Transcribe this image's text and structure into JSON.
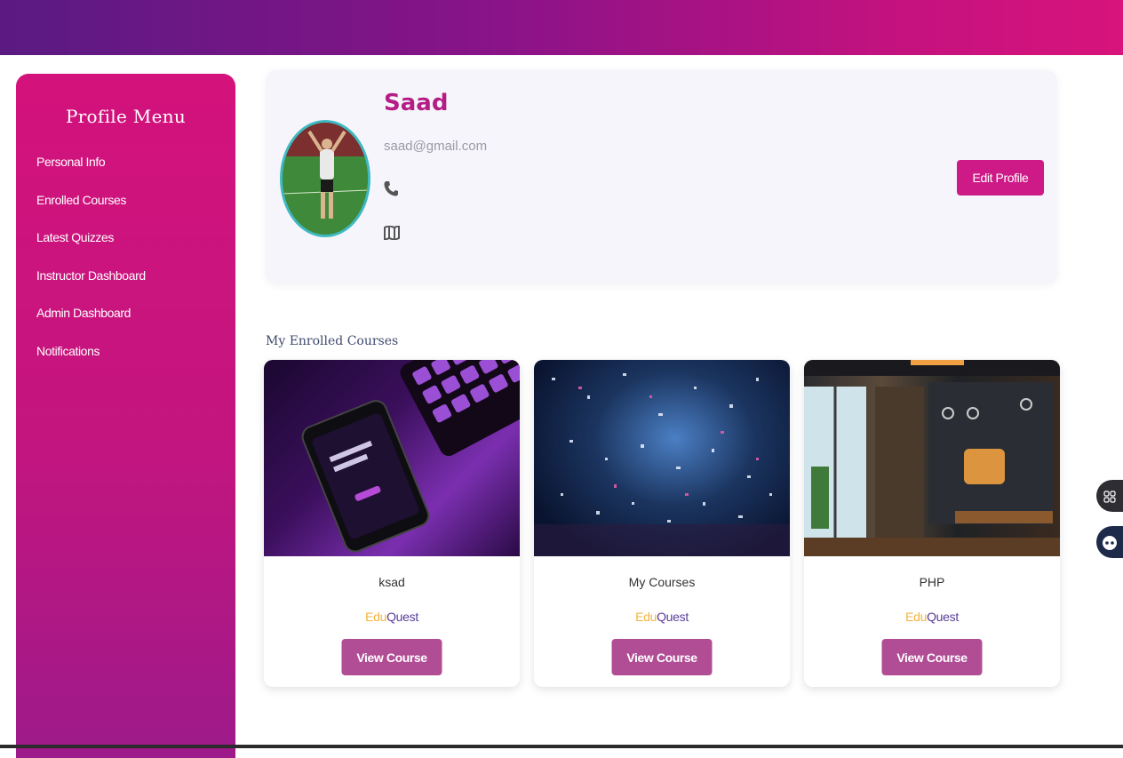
{
  "sidebar": {
    "title": "Profile Menu",
    "items": [
      {
        "label": "Personal Info"
      },
      {
        "label": "Enrolled Courses"
      },
      {
        "label": "Latest Quizzes"
      },
      {
        "label": "Instructor Dashboard"
      },
      {
        "label": "Admin Dashboard"
      },
      {
        "label": "Notifications"
      }
    ]
  },
  "profile": {
    "name": "Saad",
    "email": "saad@gmail.com",
    "phone_icon": "phone-icon",
    "address_icon": "map-icon",
    "edit_label": "Edit Profile"
  },
  "enrolled": {
    "title": "My Enrolled Courses",
    "courses": [
      {
        "title": "ksad",
        "brand_edu": "Edu",
        "brand_quest": "Quest",
        "button": "View Course"
      },
      {
        "title": "My Courses",
        "brand_edu": "Edu",
        "brand_quest": "Quest",
        "button": "View Course"
      },
      {
        "title": "PHP",
        "brand_edu": "Edu",
        "brand_quest": "Quest",
        "button": "View Course"
      }
    ]
  },
  "colors": {
    "accent": "#cd1a87",
    "brand_edu": "#f2b33d",
    "brand_quest": "#5a3d9a",
    "button": "#b04d95"
  },
  "floating": {
    "icons": [
      "grid-icon",
      "chatbot-icon"
    ]
  }
}
